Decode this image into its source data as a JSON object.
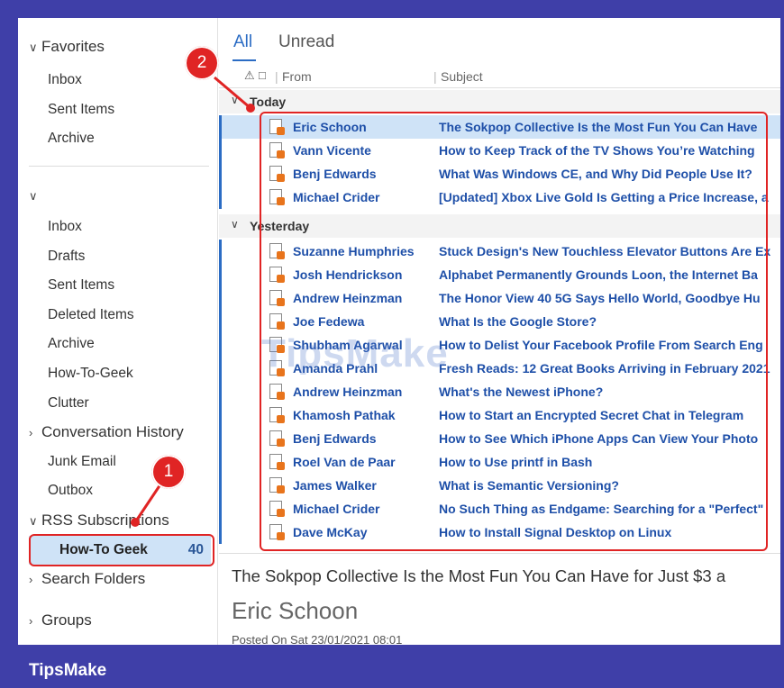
{
  "sidebar": {
    "favorites_label": "Favorites",
    "favorites": [
      "Inbox",
      "Sent Items",
      "Archive"
    ],
    "account_items": [
      "Inbox",
      "Drafts",
      "Sent Items",
      "Deleted Items",
      "Archive",
      "How-To-Geek",
      "Clutter"
    ],
    "conversation_history": "Conversation History",
    "junk": "Junk Email",
    "outbox": "Outbox",
    "rss": "RSS Subscriptions",
    "rss_selected": {
      "label": "How-To Geek",
      "count": "40"
    },
    "search_folders": "Search Folders",
    "groups": "Groups"
  },
  "tabs": {
    "all": "All",
    "unread": "Unread"
  },
  "columns": {
    "from": "From",
    "subject": "Subject"
  },
  "groups": {
    "today": {
      "label": "Today",
      "messages": [
        {
          "from": "Eric Schoon",
          "subject": "The Sokpop Collective Is the Most Fun You Can Have"
        },
        {
          "from": "Vann Vicente",
          "subject": "How to Keep Track of the TV Shows You’re Watching"
        },
        {
          "from": "Benj Edwards",
          "subject": "What Was Windows CE, and Why Did People Use It?"
        },
        {
          "from": "Michael Crider",
          "subject": "[Updated] Xbox Live Gold Is Getting a Price Increase, a"
        }
      ]
    },
    "yesterday": {
      "label": "Yesterday",
      "messages": [
        {
          "from": "Suzanne Humphries",
          "subject": "Stuck Design's New Touchless Elevator Buttons Are Ex"
        },
        {
          "from": "Josh Hendrickson",
          "subject": "Alphabet Permanently Grounds Loon, the Internet Ba"
        },
        {
          "from": "Andrew Heinzman",
          "subject": "The Honor View 40 5G Says Hello World, Goodbye Hu"
        },
        {
          "from": "Joe Fedewa",
          "subject": "What Is the Google Store?"
        },
        {
          "from": "Shubham Agarwal",
          "subject": "How to Delist Your Facebook Profile From Search Eng"
        },
        {
          "from": "Amanda Prahl",
          "subject": "Fresh Reads: 12 Great Books Arriving in February 2021"
        },
        {
          "from": "Andrew Heinzman",
          "subject": "What's the Newest iPhone?"
        },
        {
          "from": "Khamosh Pathak",
          "subject": "How to Start an Encrypted Secret Chat in Telegram"
        },
        {
          "from": "Benj Edwards",
          "subject": "How to See Which iPhone Apps Can View Your Photo"
        },
        {
          "from": "Roel Van de Paar",
          "subject": "How to Use printf in Bash"
        },
        {
          "from": "James Walker",
          "subject": "What is Semantic Versioning?"
        },
        {
          "from": "Michael Crider",
          "subject": "No Such Thing as Endgame: Searching for a \"Perfect\""
        },
        {
          "from": "Dave McKay",
          "subject": "How to Install Signal Desktop on Linux"
        }
      ]
    }
  },
  "preview": {
    "title": "The Sokpop Collective Is the Most Fun You Can Have for Just $3 a",
    "author": "Eric Schoon",
    "meta": "Posted On    Sat 23/01/2021 08:01"
  },
  "annotations": {
    "badge1": "1",
    "badge2": "2"
  },
  "brand": "TipsMake",
  "watermark": "TipsMake",
  "colors": {
    "accent": "#2b6cc4",
    "annotation": "#e02424",
    "frame": "#3f3fa8",
    "selection": "#cfe3f7"
  }
}
